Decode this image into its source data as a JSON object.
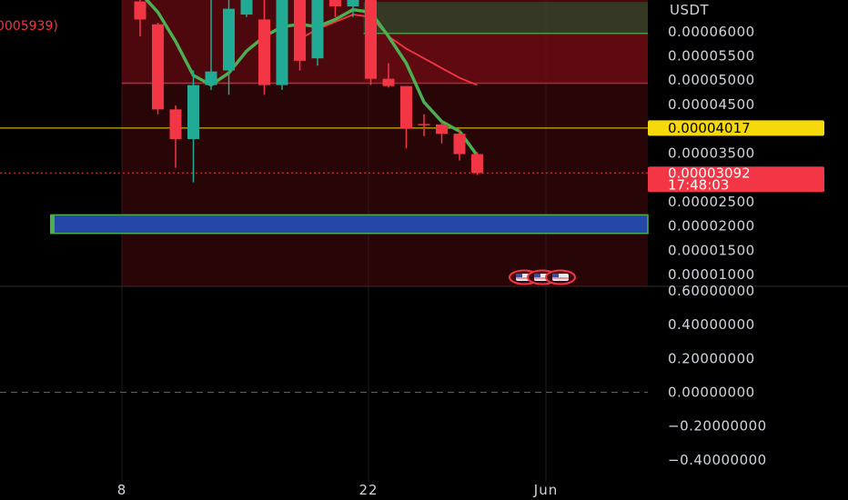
{
  "chart_data": {
    "type": "candlestick",
    "currency": "USDT",
    "legend_fragment": "0005939)",
    "price_axis": {
      "ticks": [
        "0.00006000",
        "0.00005500",
        "0.00005000",
        "0.00004500",
        "0.00003500",
        "0.00002500",
        "0.00002000",
        "0.00001500",
        "0.00001000"
      ],
      "tick_values": [
        6e-05,
        5.5e-05,
        5e-05,
        4.5e-05,
        3.5e-05,
        2.5e-05,
        2e-05,
        1.5e-05,
        1e-05
      ],
      "range": [
        7.6e-06,
        6.65e-05
      ]
    },
    "oscillator_axis": {
      "ticks": [
        "0.60000000",
        "0.40000000",
        "0.20000000",
        "0.00000000",
        "−0.20000000",
        "−0.40000000"
      ],
      "tick_values": [
        0.6,
        0.4,
        0.2,
        0,
        -0.2,
        -0.4
      ],
      "range": [
        -0.53,
        0.6
      ],
      "zero_line": 0
    },
    "time_axis": {
      "labels": [
        "8",
        "22",
        "Jun"
      ]
    },
    "horizontal_line": {
      "price": 4.017e-05,
      "label": "0.00004017",
      "color": "#f5d90a"
    },
    "last_price": {
      "price": 3.092e-05,
      "label": "0.00003092",
      "countdown": "17:48:03",
      "color": "#f23645"
    },
    "zones": [
      {
        "from_index": 0,
        "top": 6.65e-05,
        "bottom": 7.6e-06,
        "color": "#7a0e16",
        "opacity": 0.33,
        "border": ""
      },
      {
        "from_index": 0,
        "top": 6.65e-05,
        "bottom": 4.94e-05,
        "color": "#7a0e16",
        "opacity": 0.45,
        "border": "#c4283a"
      },
      {
        "from_index": 13,
        "top": 6.61e-05,
        "bottom": 5.96e-05,
        "color": "#23613a",
        "opacity": 0.55,
        "border": "#4caf50"
      },
      {
        "from_index": 13,
        "top": 5.96e-05,
        "bottom": 4.94e-05,
        "color": "#7a0e16",
        "opacity": 0.4,
        "border": ""
      }
    ],
    "support_box": {
      "top": 2.23e-05,
      "bottom": 1.85e-05,
      "color": "#2547a8",
      "border": "#4caf50"
    },
    "candles": [
      {
        "o": 6.62e-05,
        "h": 6.65e-05,
        "l": 5.9e-05,
        "c": 6.25e-05
      },
      {
        "o": 6.15e-05,
        "h": 6.18e-05,
        "l": 4.3e-05,
        "c": 4.4e-05
      },
      {
        "o": 4.4e-05,
        "h": 4.48e-05,
        "l": 3.2e-05,
        "c": 3.79e-05
      },
      {
        "o": 3.79e-05,
        "h": 5.2e-05,
        "l": 2.9e-05,
        "c": 4.9e-05
      },
      {
        "o": 4.9e-05,
        "h": 6.65e-05,
        "l": 4.8e-05,
        "c": 5.18e-05
      },
      {
        "o": 5.2e-05,
        "h": 6.65e-05,
        "l": 4.7e-05,
        "c": 6.47e-05
      },
      {
        "o": 6.35e-05,
        "h": 6.65e-05,
        "l": 6.3e-05,
        "c": 6.65e-05
      },
      {
        "o": 6.25e-05,
        "h": 6.65e-05,
        "l": 4.7e-05,
        "c": 4.9e-05
      },
      {
        "o": 4.9e-05,
        "h": 6.65e-05,
        "l": 4.8e-05,
        "c": 6.65e-05
      },
      {
        "o": 6.65e-05,
        "h": 6.65e-05,
        "l": 5.2e-05,
        "c": 5.4e-05
      },
      {
        "o": 5.45e-05,
        "h": 6.65e-05,
        "l": 5.3e-05,
        "c": 6.65e-05
      },
      {
        "o": 6.65e-05,
        "h": 6.65e-05,
        "l": 6.3e-05,
        "c": 6.52e-05
      },
      {
        "o": 6.52e-05,
        "h": 6.65e-05,
        "l": 6.3e-05,
        "c": 6.65e-05
      },
      {
        "o": 6.65e-05,
        "h": 6.65e-05,
        "l": 4.9e-05,
        "c": 5.03e-05
      },
      {
        "o": 5.03e-05,
        "h": 5.35e-05,
        "l": 4.85e-05,
        "c": 4.88e-05
      },
      {
        "o": 4.88e-05,
        "h": 4.88e-05,
        "l": 3.6e-05,
        "c": 4e-05
      },
      {
        "o": 4.1e-05,
        "h": 4.3e-05,
        "l": 3.85e-05,
        "c": 4.08e-05
      },
      {
        "o": 4.09e-05,
        "h": 4.15e-05,
        "l": 3.7e-05,
        "c": 3.9e-05
      },
      {
        "o": 3.9e-05,
        "h": 3.98e-05,
        "l": 3.35e-05,
        "c": 3.48e-05
      },
      {
        "o": 3.48e-05,
        "h": 3.52e-05,
        "l": 3.05e-05,
        "c": 3.09e-05
      }
    ],
    "ma_fast": {
      "color": "#4caf50",
      "values": [
        6.8e-05,
        6.4e-05,
        5.8e-05,
        5.1e-05,
        4.9e-05,
        5.15e-05,
        5.6e-05,
        5.9e-05,
        6.1e-05,
        6.15e-05,
        6.1e-05,
        6.25e-05,
        6.45e-05,
        6.4e-05,
        5.9e-05,
        5.35e-05,
        4.55e-05,
        4.15e-05,
        3.95e-05,
        3.45e-05
      ]
    },
    "ma_slow": {
      "color": "#f23645",
      "values": [
        null,
        null,
        null,
        null,
        null,
        null,
        null,
        null,
        null,
        5.85e-05,
        6.05e-05,
        6.2e-05,
        6.35e-05,
        6.3e-05,
        5.9e-05,
        5.65e-05,
        5.45e-05,
        5.25e-05,
        5.05e-05,
        4.9e-05
      ]
    },
    "markers": {
      "count": 3,
      "color": "#f23645"
    },
    "colors": {
      "up": "#22ab94",
      "down": "#f23645",
      "background": "#000000",
      "grid": "#1c1c1c"
    }
  }
}
